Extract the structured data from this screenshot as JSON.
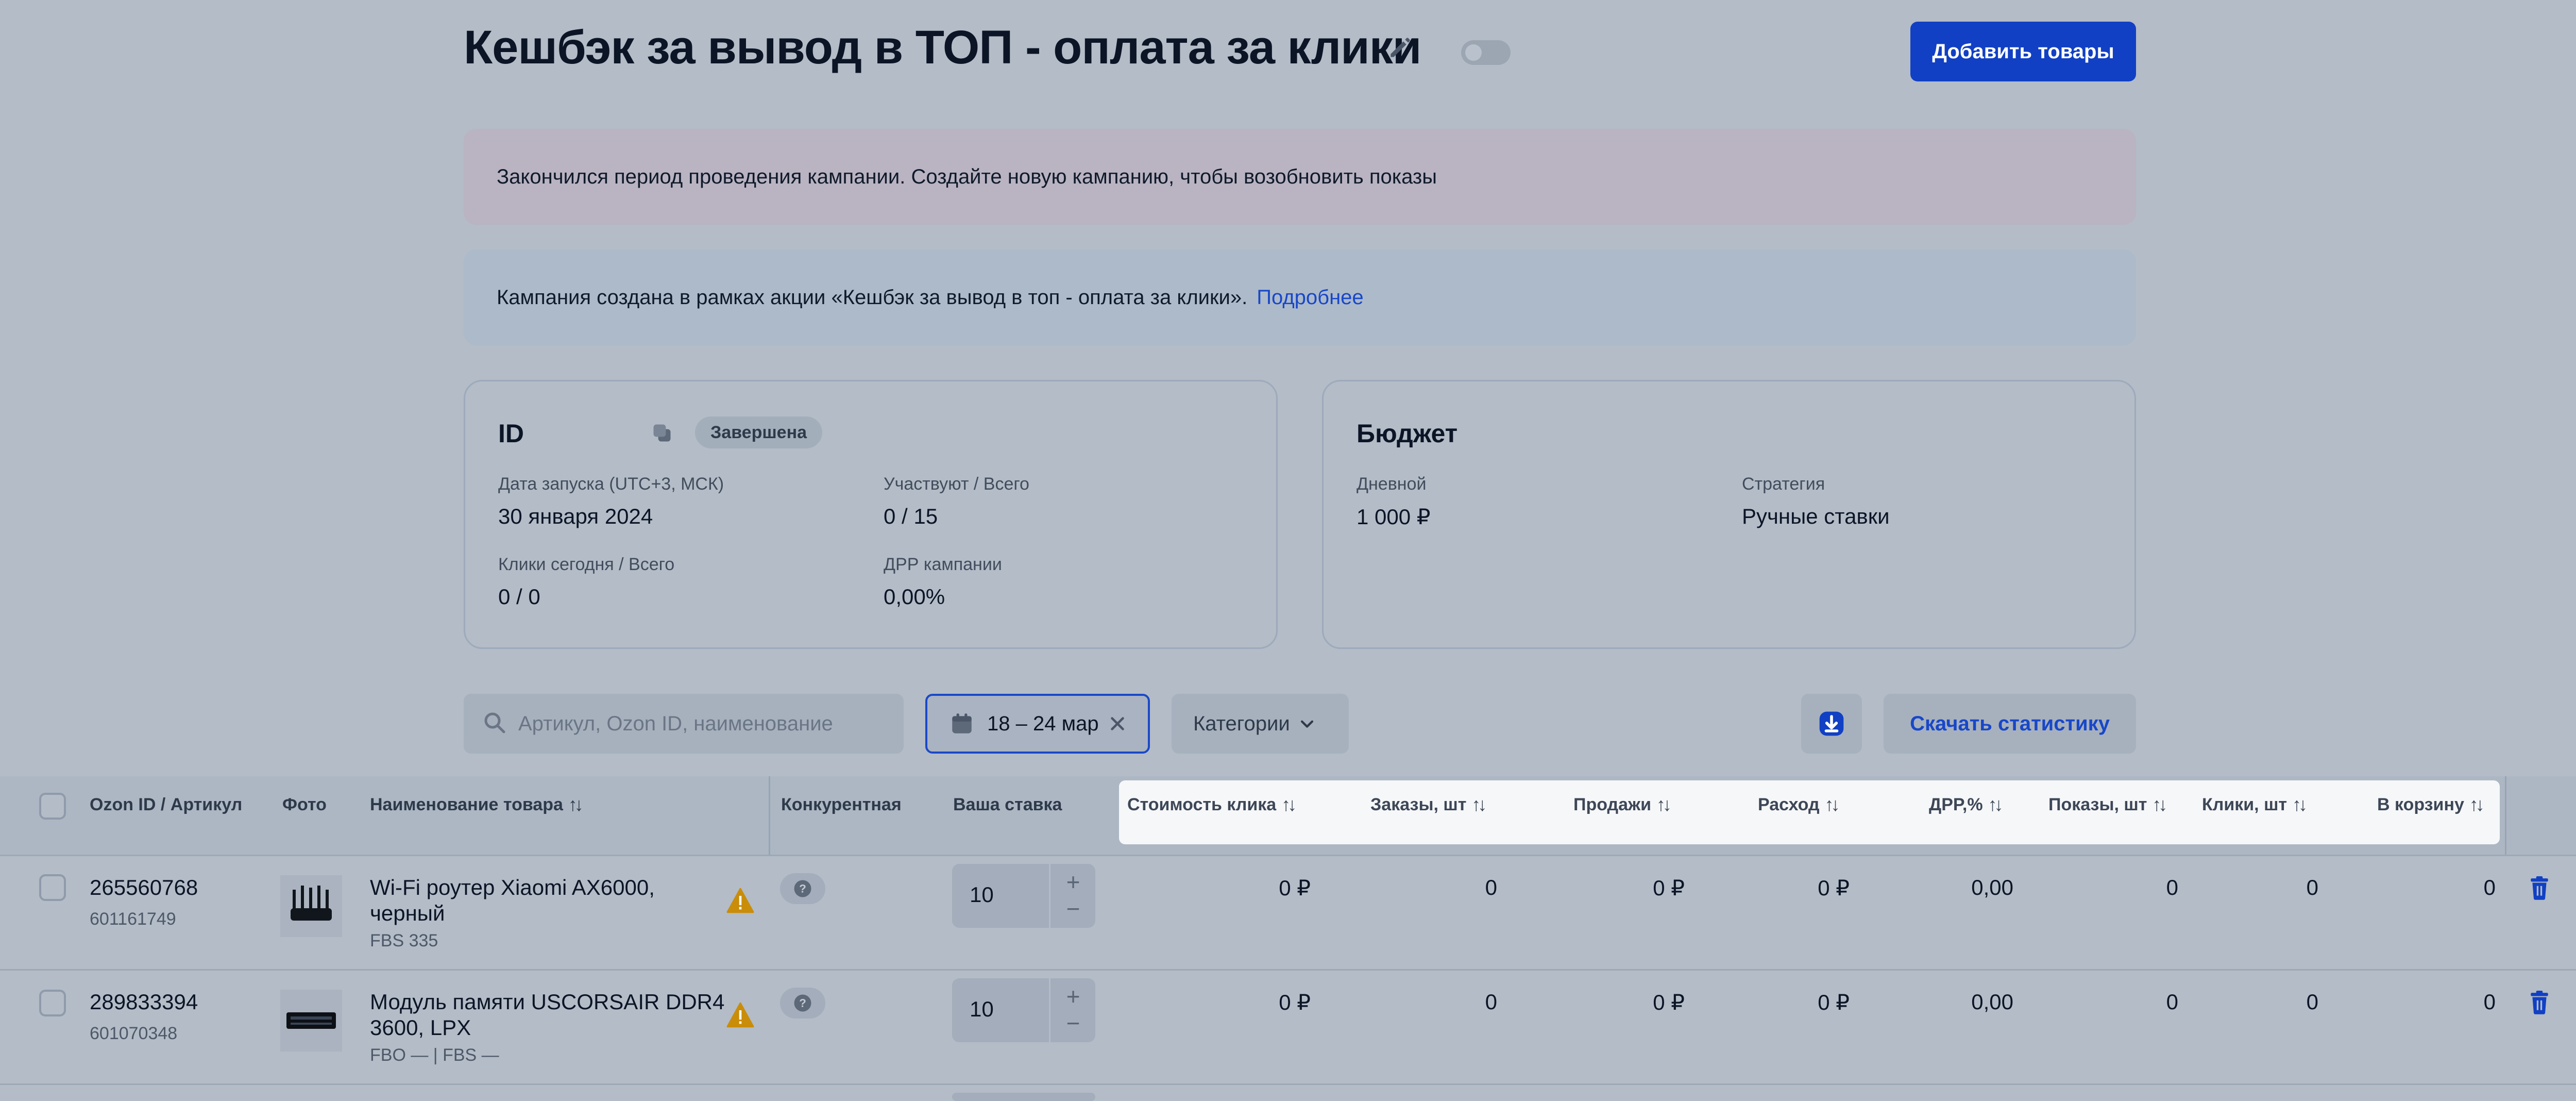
{
  "header": {
    "title": "Кешбэк за вывод в ТОП - оплата за клики",
    "add_button": "Добавить товары"
  },
  "banners": {
    "ended": "Закончился период проведения кампании. Создайте новую кампанию, чтобы возобновить показы",
    "promo_text": "Кампания создана в рамках акции «Кешбэк за вывод в топ - оплата за клики».",
    "promo_link": "Подробнее"
  },
  "card_id": {
    "title": "ID",
    "status": "Завершена",
    "launch_label": "Дата запуска (UTC+3, МСК)",
    "launch_value": "30 января 2024",
    "participate_label": "Участвуют / Всего",
    "participate_value": "0 / 15",
    "clicks_label": "Клики сегодня / Всего",
    "clicks_value": "0 / 0",
    "drr_label": "ДРР кампании",
    "drr_value": "0,00%"
  },
  "card_budget": {
    "title": "Бюджет",
    "daily_label": "Дневной",
    "daily_value": "1 000 ₽",
    "strategy_label": "Стратегия",
    "strategy_value": "Ручные ставки"
  },
  "toolbar": {
    "search_placeholder": "Артикул, Ozon ID, наименование",
    "date_range": "18 – 24 мар",
    "categories": "Категории",
    "download_stats": "Скачать статистику"
  },
  "table": {
    "columns": {
      "id": "Ozon ID / Артикул",
      "photo": "Фото",
      "name": "Наименование товара",
      "competitive": "Конкурентная",
      "bid": "Ваша ставка",
      "click_cost": "Стоимость клика",
      "orders": "Заказы, шт",
      "sales": "Продажи",
      "spend": "Расход",
      "drr": "ДРР,%",
      "views": "Показы, шт",
      "clicks": "Клики, шт",
      "cart": "В корзину"
    },
    "rows": [
      {
        "ozon_id": "265560768",
        "article": "601161749",
        "name_line1": "Wi-Fi роутер Xiaomi AX6000,",
        "name_line2": "черный",
        "stock": "FBS 335",
        "bid": "10",
        "click_cost": "0 ₽",
        "orders": "0",
        "sales": "0 ₽",
        "spend": "0 ₽",
        "drr": "0,00",
        "views": "0",
        "clicks": "0",
        "cart": "0"
      },
      {
        "ozon_id": "289833394",
        "article": "601070348",
        "name_line1": "Модуль памяти USCORSAIR DDR4",
        "name_line2": "3600, LPX",
        "stock": "FBO — | FBS —",
        "bid": "10",
        "click_cost": "0 ₽",
        "orders": "0",
        "sales": "0 ₽",
        "spend": "0 ₽",
        "drr": "0,00",
        "views": "0",
        "clicks": "0",
        "cart": "0"
      }
    ]
  },
  "colors": {
    "accent": "#1140c4",
    "link": "#1847c8",
    "warning": "#c98d0a",
    "background": "#b3bcc7"
  },
  "icons": [
    "pencil-icon",
    "copy-icon",
    "search-icon",
    "calendar-icon",
    "close-icon",
    "chevron-down-icon",
    "download-icon",
    "sort-icon",
    "warning-icon",
    "question-icon",
    "trash-icon"
  ]
}
